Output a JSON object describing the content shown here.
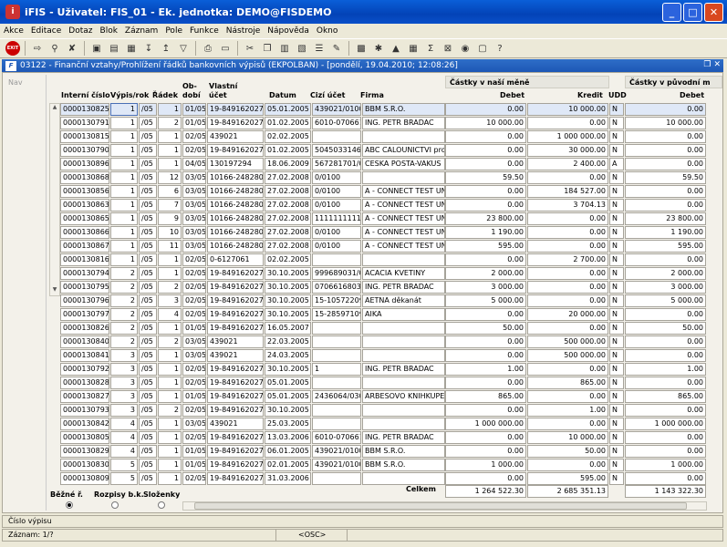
{
  "window": {
    "title": "iFIS - Uživatel: FIS_01 - Ek. jednotka: DEMO@FISDEMO",
    "app_icon_text": "i"
  },
  "menu": [
    "Akce",
    "Editace",
    "Dotaz",
    "Blok",
    "Záznam",
    "Pole",
    "Funkce",
    "Nástroje",
    "Nápověda",
    "Okno"
  ],
  "toolbar": {
    "exit_label": "EXIT"
  },
  "document": {
    "title": "03122 - Finanční vztahy/Prohlížení řádků bankovních výpisů (EKPOLBAN) - [pondělí, 19.04.2010; 12:08:26]",
    "icon_text": "F"
  },
  "nav_label": "Nav",
  "group_headers": {
    "own_currency": "Částky v naší měně",
    "orig_currency": "Částky v původní m"
  },
  "columns": {
    "interni": "Interní číslo",
    "vypis": "Výpis/rok",
    "radek": "Řádek",
    "obdobi": "Ob-dobí",
    "vlastni": "Vlastní účet",
    "datum": "Datum",
    "cizi": "Cizí účet",
    "firma": "Firma",
    "debet": "Debet",
    "kredit": "Kredit",
    "udd": "UDD",
    "debet2": "Debet"
  },
  "rows": [
    [
      "0000130825",
      "1",
      "/05",
      "1",
      "01/05",
      "19-8491620277",
      "05.01.2005",
      "439021/0100",
      "BBM S.R.O.",
      "0.00",
      "10 000.00",
      "N",
      "0.00"
    ],
    [
      "0000130791",
      "1",
      "/05",
      "2",
      "01/05",
      "19-8491620277",
      "01.02.2005",
      "6010-0706616",
      "ING. PETR BRADAC",
      "10 000.00",
      "0.00",
      "N",
      "10 000.00"
    ],
    [
      "0000130815",
      "1",
      "/05",
      "1",
      "02/05",
      "439021",
      "02.02.2005",
      "",
      "",
      "0.00",
      "1 000 000.00",
      "N",
      "0.00"
    ],
    [
      "0000130790",
      "1",
      "/05",
      "1",
      "02/05",
      "19-8491620277",
      "01.02.2005",
      "5045033146/0",
      "ABC CALOUNICTVI pro",
      "0.00",
      "30 000.00",
      "N",
      "0.00"
    ],
    [
      "0000130896",
      "1",
      "/05",
      "1",
      "04/05",
      "130197294",
      "18.06.2009",
      "567281701/01",
      "CESKA POSTA-VAKUS",
      "0.00",
      "2 400.00",
      "A",
      "0.00"
    ],
    [
      "0000130868",
      "1",
      "/05",
      "12",
      "03/05",
      "10166-2482809",
      "27.02.2008",
      "0/0100",
      "",
      "59.50",
      "0.00",
      "N",
      "59.50"
    ],
    [
      "0000130856",
      "1",
      "/05",
      "6",
      "03/05",
      "10166-2482809",
      "27.02.2008",
      "0/0100",
      "A - CONNECT TEST UNI",
      "0.00",
      "184 527.00",
      "N",
      "0.00"
    ],
    [
      "0000130863",
      "1",
      "/05",
      "7",
      "03/05",
      "10166-2482809",
      "27.02.2008",
      "0/0100",
      "A - CONNECT TEST UNI",
      "0.00",
      "3 704.13",
      "N",
      "0.00"
    ],
    [
      "0000130865",
      "1",
      "/05",
      "9",
      "03/05",
      "10166-2482809",
      "27.02.2008",
      "1111111111/0",
      "A - CONNECT TEST UNI",
      "23 800.00",
      "0.00",
      "N",
      "23 800.00"
    ],
    [
      "0000130866",
      "1",
      "/05",
      "10",
      "03/05",
      "10166-2482809",
      "27.02.2008",
      "0/0100",
      "A - CONNECT TEST UNI",
      "1 190.00",
      "0.00",
      "N",
      "1 190.00"
    ],
    [
      "0000130867",
      "1",
      "/05",
      "11",
      "03/05",
      "10166-2482809",
      "27.02.2008",
      "0/0100",
      "A - CONNECT TEST UNI",
      "595.00",
      "0.00",
      "N",
      "595.00"
    ],
    [
      "0000130816",
      "1",
      "/05",
      "1",
      "02/05",
      "0-6127061",
      "02.02.2005",
      "",
      "",
      "0.00",
      "2 700.00",
      "N",
      "0.00"
    ],
    [
      "0000130794",
      "2",
      "/05",
      "1",
      "02/05",
      "19-8491620277",
      "30.10.2005",
      "999689031/01",
      "ACACIA KVETINY",
      "2 000.00",
      "0.00",
      "N",
      "2 000.00"
    ],
    [
      "0000130795",
      "2",
      "/05",
      "2",
      "02/05",
      "19-8491620277",
      "30.10.2005",
      "0706616803/0",
      "ING. PETR BRADAC",
      "3 000.00",
      "0.00",
      "N",
      "3 000.00"
    ],
    [
      "0000130796",
      "2",
      "/05",
      "3",
      "02/05",
      "19-8491620277",
      "30.10.2005",
      "15-10572209/",
      "AETNA děkanát",
      "5 000.00",
      "0.00",
      "N",
      "5 000.00"
    ],
    [
      "0000130797",
      "2",
      "/05",
      "4",
      "02/05",
      "19-8491620277",
      "30.10.2005",
      "15-2859710951",
      "AIKA",
      "0.00",
      "20 000.00",
      "N",
      "0.00"
    ],
    [
      "0000130826",
      "2",
      "/05",
      "1",
      "01/05",
      "19-8491620277",
      "16.05.2007",
      "",
      "",
      "50.00",
      "0.00",
      "N",
      "50.00"
    ],
    [
      "0000130840",
      "2",
      "/05",
      "2",
      "03/05",
      "439021",
      "22.03.2005",
      "",
      "",
      "0.00",
      "500 000.00",
      "N",
      "0.00"
    ],
    [
      "0000130841",
      "3",
      "/05",
      "1",
      "03/05",
      "439021",
      "24.03.2005",
      "",
      "",
      "0.00",
      "500 000.00",
      "N",
      "0.00"
    ],
    [
      "0000130792",
      "3",
      "/05",
      "1",
      "02/05",
      "19-8491620277",
      "30.10.2005",
      "1",
      "ING. PETR BRADAC",
      "1.00",
      "0.00",
      "N",
      "1.00"
    ],
    [
      "0000130828",
      "3",
      "/05",
      "1",
      "02/05",
      "19-8491620277",
      "05.01.2005",
      "",
      "",
      "0.00",
      "865.00",
      "N",
      "0.00"
    ],
    [
      "0000130827",
      "3",
      "/05",
      "1",
      "01/05",
      "19-8491620277",
      "05.01.2005",
      "2436064/0300",
      "ARBESOVO KNIHKUPEC",
      "865.00",
      "0.00",
      "N",
      "865.00"
    ],
    [
      "0000130793",
      "3",
      "/05",
      "2",
      "02/05",
      "19-8491620277",
      "30.10.2005",
      "",
      "",
      "0.00",
      "1.00",
      "N",
      "0.00"
    ],
    [
      "0000130842",
      "4",
      "/05",
      "1",
      "03/05",
      "439021",
      "25.03.2005",
      "",
      "",
      "1 000 000.00",
      "0.00",
      "N",
      "1 000 000.00"
    ],
    [
      "0000130805",
      "4",
      "/05",
      "1",
      "02/05",
      "19-8491620277",
      "13.03.2006",
      "6010-0706616",
      "ING. PETR BRADAC",
      "0.00",
      "10 000.00",
      "N",
      "0.00"
    ],
    [
      "0000130829",
      "4",
      "/05",
      "1",
      "01/05",
      "19-8491620277",
      "06.01.2005",
      "439021/0100",
      "BBM S.R.O.",
      "0.00",
      "50.00",
      "N",
      "0.00"
    ],
    [
      "0000130830",
      "5",
      "/05",
      "1",
      "01/05",
      "19-8491620277",
      "02.01.2005",
      "439021/0100",
      "BBM S.R.O.",
      "1 000.00",
      "0.00",
      "N",
      "1 000.00"
    ],
    [
      "0000130809",
      "5",
      "/05",
      "1",
      "02/05",
      "19-8491620277",
      "31.03.2006",
      "",
      "",
      "0.00",
      "595.00",
      "N",
      "0.00"
    ]
  ],
  "totals": {
    "label": "Celkem",
    "debet": "1 264 522.30",
    "kredit": "2 685 351.13",
    "debet2": "1 143 322.30"
  },
  "radios": {
    "bezne": "Běžné ř.",
    "rozpisy": "Rozpisy b.k.",
    "slozenky": "Složenky",
    "selected": "bezne"
  },
  "status": {
    "field": "Číslo výpisu",
    "record": "Záznam: 1/?",
    "mode": "<OSC>"
  }
}
